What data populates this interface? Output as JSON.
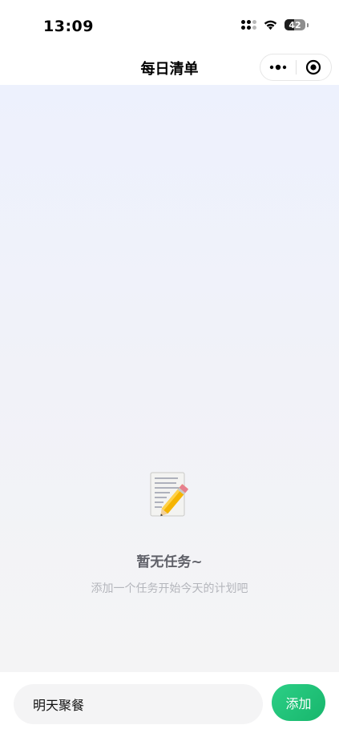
{
  "status_bar": {
    "time": "13:09",
    "battery": "42"
  },
  "nav": {
    "title": "每日清单",
    "more_icon": "more-dots-icon",
    "close_icon": "target-circle-icon"
  },
  "empty_state": {
    "icon": "memo-pencil-icon",
    "title": "暂无任务~",
    "hint": "添加一个任务开始今天的计划吧"
  },
  "composer": {
    "input_value": "明天聚餐",
    "add_label": "添加"
  },
  "colors": {
    "accent": "#1fc27a",
    "background_top": "#edf1fd",
    "background_bottom": "#f4f4f5"
  }
}
